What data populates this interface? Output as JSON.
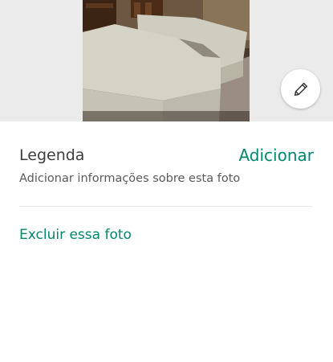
{
  "photo": {
    "image_icon": "photo-bedroom",
    "edit_icon": "pencil-icon"
  },
  "caption": {
    "title": "Legenda",
    "add_label": "Adicionar",
    "description": "Adicionar informações sobre esta foto"
  },
  "actions": {
    "delete_label": "Excluir essa foto"
  },
  "colors": {
    "accent": "#00876c",
    "text_primary": "#3c3c3c",
    "text_secondary": "#5a5a5a",
    "photo_background": "#ebebeb"
  }
}
